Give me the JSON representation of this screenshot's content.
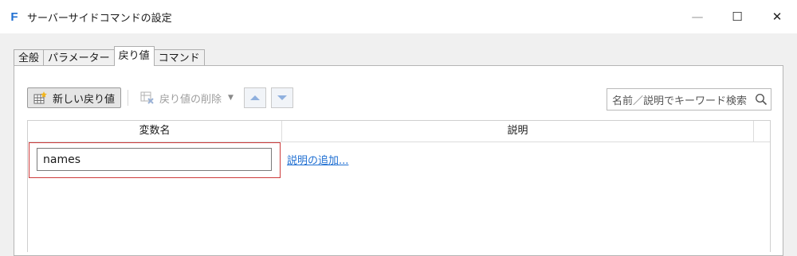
{
  "window": {
    "title": "サーバーサイドコマンドの設定",
    "app_icon_letter": "F",
    "controls": {
      "minimize": "—",
      "maximize": "☐",
      "close": "✕"
    }
  },
  "tabs": [
    {
      "label": "全般",
      "active": false
    },
    {
      "label": "パラメーター",
      "active": false
    },
    {
      "label": "戻り値",
      "active": true
    },
    {
      "label": "コマンド",
      "active": false
    }
  ],
  "toolbar": {
    "new_label": "新しい戻り値",
    "delete_label": "戻り値の削除",
    "dropdown_caret": "▼"
  },
  "search": {
    "placeholder": "名前／説明でキーワード検索"
  },
  "grid": {
    "columns": [
      "変数名",
      "説明"
    ],
    "rows": [
      {
        "name": "names",
        "description_link": "説明の追加..."
      }
    ]
  },
  "colors": {
    "accent": "#1f6fd2",
    "highlight_border": "#cc3b3b"
  }
}
